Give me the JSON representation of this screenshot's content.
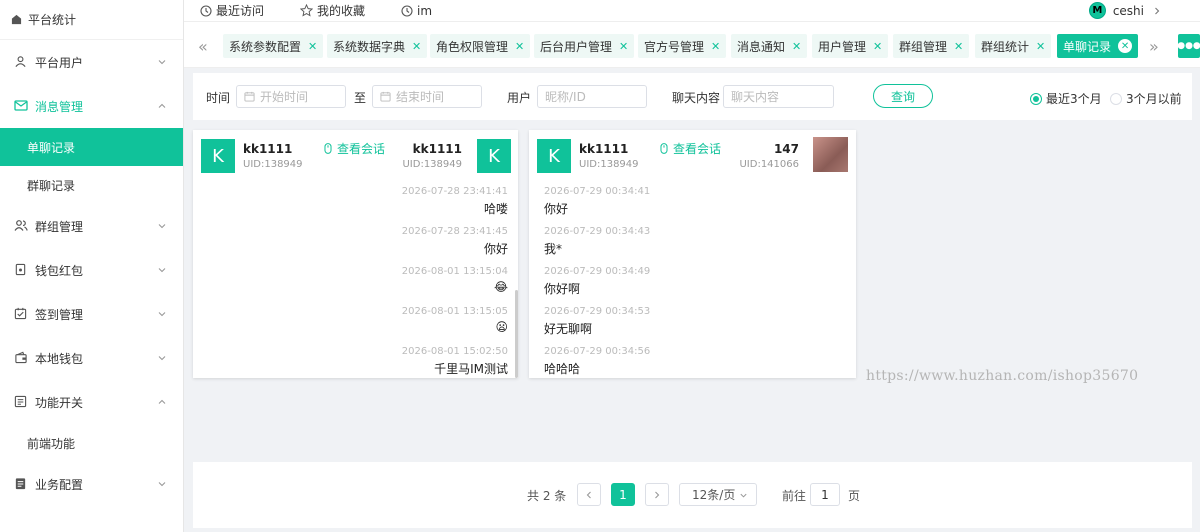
{
  "app": {
    "title": "平台统计"
  },
  "sidebar": {
    "items": [
      {
        "label": "平台用户",
        "icon": "user-icon"
      },
      {
        "label": "消息管理",
        "icon": "message-icon",
        "open": true
      },
      {
        "label": "单聊记录",
        "sub": true,
        "active": true
      },
      {
        "label": "群聊记录",
        "sub": true
      },
      {
        "label": "群组管理",
        "icon": "group-icon"
      },
      {
        "label": "钱包红包",
        "icon": "wallet-icon"
      },
      {
        "label": "签到管理",
        "icon": "checkin-icon"
      },
      {
        "label": "本地钱包",
        "icon": "local-wallet-icon"
      },
      {
        "label": "功能开关",
        "icon": "switch-icon",
        "open": true
      },
      {
        "label": "前端功能",
        "sub": true
      },
      {
        "label": "业务配置",
        "icon": "config-icon"
      }
    ]
  },
  "topbar": {
    "recent": "最近访问",
    "favorites": "我的收藏",
    "im": "im",
    "user_initial": "M",
    "username": "ceshi"
  },
  "tabs": [
    {
      "label": "系统参数配置"
    },
    {
      "label": "系统数据字典"
    },
    {
      "label": "角色权限管理"
    },
    {
      "label": "后台用户管理"
    },
    {
      "label": "官方号管理"
    },
    {
      "label": "消息通知"
    },
    {
      "label": "用户管理"
    },
    {
      "label": "群组管理"
    },
    {
      "label": "群组统计"
    },
    {
      "label": "单聊记录",
      "active": true
    }
  ],
  "filter": {
    "time_label": "时间",
    "start_placeholder": "开始时间",
    "to_label": "至",
    "end_placeholder": "结束时间",
    "user_label": "用户",
    "user_placeholder": "昵称/ID",
    "content_label": "聊天内容",
    "content_placeholder": "聊天内容",
    "query_button": "查询",
    "radio_recent": "最近3个月",
    "radio_older": "3个月以前",
    "selected": "recent"
  },
  "cards": [
    {
      "left_name": "kk1111",
      "left_uid": "UID:138949",
      "left_avatar": "K",
      "view_label": "查看会话",
      "right_name": "kk1111",
      "right_uid": "UID:138949",
      "right_avatar": "K",
      "messages": [
        {
          "time": "2026-07-28 23:41:41",
          "text": "哈喽"
        },
        {
          "time": "2026-07-28 23:41:45",
          "text": "你好"
        },
        {
          "time": "2026-08-01 13:15:04",
          "text": "😂"
        },
        {
          "time": "2026-08-01 13:15:05",
          "text": "😦"
        },
        {
          "time": "2026-08-01 15:02:50",
          "text": "千里马IM测试"
        }
      ]
    },
    {
      "left_name": "kk1111",
      "left_uid": "UID:138949",
      "left_avatar": "K",
      "view_label": "查看会话",
      "right_name": "147",
      "right_uid": "UID:141066",
      "messages": [
        {
          "time": "2026-07-29 00:34:41",
          "text": "你好"
        },
        {
          "time": "2026-07-29 00:34:43",
          "text": "我*"
        },
        {
          "time": "2026-07-29 00:34:49",
          "text": "你好啊"
        },
        {
          "time": "2026-07-29 00:34:53",
          "text": "好无聊啊"
        },
        {
          "time": "2026-07-29 00:34:56",
          "text": "哈哈哈"
        }
      ]
    }
  ],
  "watermark": "https://www.huzhan.com/ishop35670",
  "pagination": {
    "total": "共 2 条",
    "current": "1",
    "page_size": "12条/页",
    "goto_label": "前往",
    "goto_value": "1",
    "page_unit": "页"
  },
  "colors": {
    "accent": "#10c29a"
  }
}
